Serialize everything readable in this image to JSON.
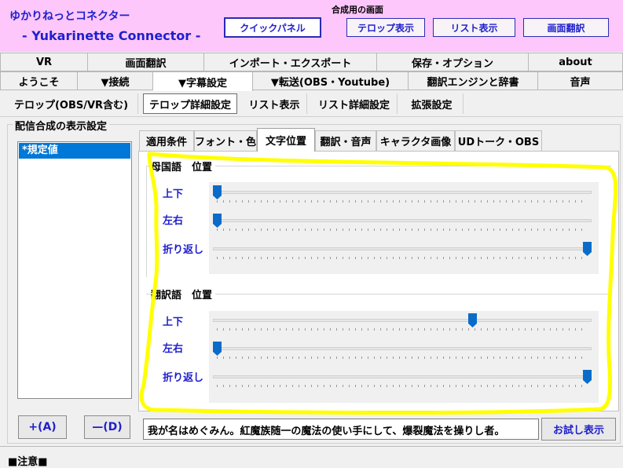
{
  "header": {
    "title": "ゆかりねっとコネクター",
    "subtitle": "- Yukarinette Connector -",
    "composite_label": "合成用の画面",
    "quick_panel": "クイックパネル",
    "telop_display": "テロップ表示",
    "list_display": "リスト表示",
    "screen_translate": "画面翻訳"
  },
  "main_tabs_row1": [
    "VR",
    "画面翻訳",
    "インポート・エクスポート",
    "保存・オプション",
    "about"
  ],
  "main_tabs_row2": [
    "ようこそ",
    "▼接続",
    "▼字幕設定",
    "▼転送(OBS・Youtube)",
    "翻訳エンジンと辞書",
    "音声"
  ],
  "active_main_tab": "▼字幕設定",
  "sub_tabs": [
    "テロップ(OBS/VR含む)",
    "テロップ詳細設定",
    "リスト表示",
    "リスト詳細設定",
    "拡張設定"
  ],
  "active_sub_tab": "テロップ詳細設定",
  "group_label": "配信合成の表示設定",
  "preset_list": [
    "*規定値"
  ],
  "add_button": "+(A)",
  "delete_button": "—(D)",
  "inner_tabs": [
    "適用条件",
    "フォント・色",
    "文字位置",
    "翻訳・音声",
    "キャラクタ画像",
    "UDトーク・OBS"
  ],
  "active_inner_tab": "文字位置",
  "native_section": {
    "title": "母国語　位置",
    "sliders": [
      {
        "label": "上下",
        "value_fraction": 0.0
      },
      {
        "label": "左右",
        "value_fraction": 0.0
      },
      {
        "label": "折り返し",
        "value_fraction": 1.0
      }
    ]
  },
  "translated_section": {
    "title": "翻訳語　位置",
    "sliders": [
      {
        "label": "上下",
        "value_fraction": 0.69
      },
      {
        "label": "左右",
        "value_fraction": 0.0
      },
      {
        "label": "折り返し",
        "value_fraction": 1.0
      }
    ]
  },
  "trial_text": "我が名はめぐみん。紅魔族随一の魔法の使い手にして、爆裂魔法を操りし者。",
  "trial_button": "お試し表示",
  "notice_label": "■注意■",
  "colors": {
    "header_bg": "#fdc7fb",
    "accent_blue": "#1f1fcc",
    "selection": "#0078d7",
    "slider_thumb": "#0a6cc8",
    "highlight": "#ffff00"
  }
}
